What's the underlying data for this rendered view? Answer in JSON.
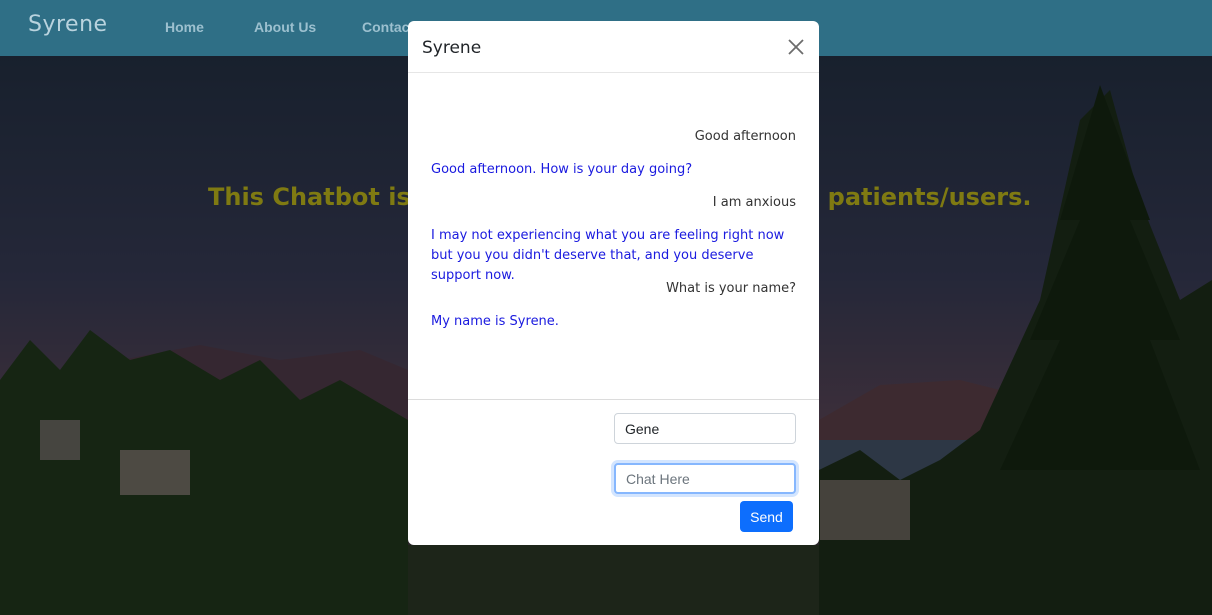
{
  "navbar": {
    "brand": "Syrene",
    "links": [
      "Home",
      "About Us",
      "Contact"
    ]
  },
  "hero": {
    "text_left": "This Chatbot is n",
    "text_right": "e patients/users."
  },
  "modal": {
    "title": "Syrene",
    "messages": [
      {
        "sender": "user",
        "text": "Good afternoon"
      },
      {
        "sender": "bot",
        "text": "Good afternoon. How is your day going?"
      },
      {
        "sender": "user",
        "text": "I am anxious"
      },
      {
        "sender": "bot",
        "text": "I may not experiencing what you are feeling right now but you you didn't deserve that, and you deserve support now."
      },
      {
        "sender": "user",
        "text": "What is your name?"
      },
      {
        "sender": "bot",
        "text": "My name is Syrene."
      }
    ],
    "name_value": "Gene",
    "chat_placeholder": "Chat Here",
    "send_label": "Send"
  },
  "colors": {
    "navbar": "#2f6f86",
    "bot_text": "#1a1adf",
    "send_button": "#0d6efd",
    "hero_text": "#7f7a12"
  }
}
